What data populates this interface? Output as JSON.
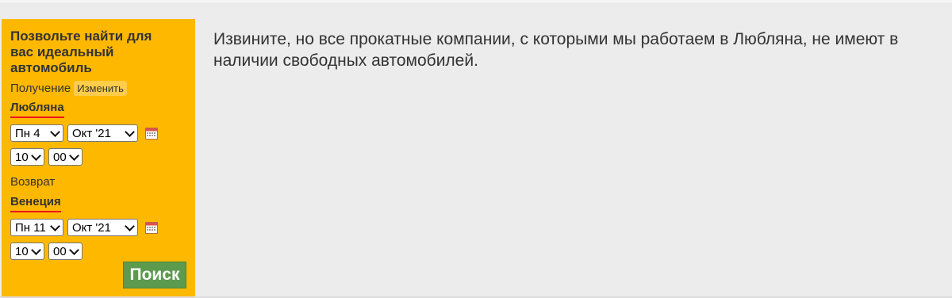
{
  "panel": {
    "title": "Позвольте найти для вас идеальный автомобиль",
    "pickup": {
      "label": "Получение",
      "change_label": "Изменить",
      "city": "Любляна",
      "day": "Пн 4",
      "month": "Окт '21",
      "hour": "10",
      "minute": "00"
    },
    "return": {
      "label": "Возврат",
      "city": "Венеция",
      "day": "Пн 11",
      "month": "Окт '21",
      "hour": "10",
      "minute": "00"
    },
    "search_label": "Поиск"
  },
  "message": "Извините, но все прокатные компании, с которыми мы работаем в Любляна, не имеют в наличии свободных автомобилей.",
  "colors": {
    "panel_bg": "#ffb800",
    "search_button": "#5c9a4e",
    "underline": "#e8141e"
  },
  "icons": {
    "calendar": "calendar-icon",
    "dropdown": "chevron-down-icon"
  }
}
